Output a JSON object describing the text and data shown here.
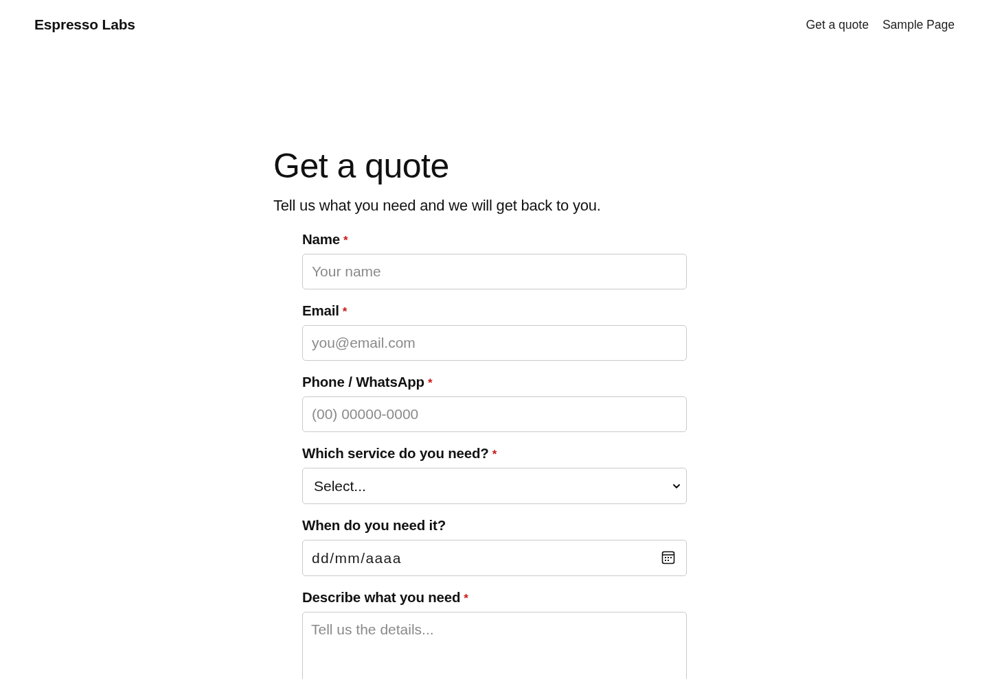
{
  "header": {
    "site_title": "Espresso Labs",
    "nav": [
      {
        "label": "Get a quote"
      },
      {
        "label": "Sample Page"
      }
    ]
  },
  "page": {
    "title": "Get a quote",
    "intro": "Tell us what you need and we will get back to you."
  },
  "form": {
    "fields": [
      {
        "kind": "text",
        "label": "Name",
        "required_mark": "*",
        "placeholder": "Your name"
      },
      {
        "kind": "text",
        "label": "Email",
        "required_mark": "*",
        "placeholder": "you@email.com"
      },
      {
        "kind": "text",
        "label": "Phone / WhatsApp",
        "required_mark": "*",
        "placeholder": "(00) 00000-0000"
      },
      {
        "kind": "select",
        "label": "Which service do you need?",
        "required_mark": "*",
        "value": "Select..."
      },
      {
        "kind": "date",
        "label": "When do you need it?",
        "value": "dd/mm/aaaa"
      },
      {
        "kind": "textarea",
        "label": "Describe what you need",
        "required_mark": "*",
        "placeholder": "Tell us the details..."
      }
    ]
  }
}
